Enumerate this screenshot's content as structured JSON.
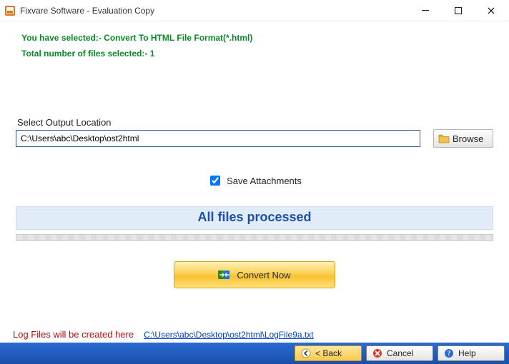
{
  "window": {
    "title": "Fixvare Software - Evaluation Copy"
  },
  "info": {
    "selected_line": "You have selected:- Convert To HTML File Format(*.html)",
    "count_line": "Total number of files selected:- 1"
  },
  "output": {
    "label": "Select Output Location",
    "path": "C:\\Users\\abc\\Desktop\\ost2html",
    "browse_label": "Browse"
  },
  "options": {
    "save_attachments_label": "Save Attachments",
    "save_attachments_checked": true
  },
  "status": {
    "text": "All files processed"
  },
  "actions": {
    "convert_label": "Convert Now"
  },
  "log": {
    "label": "Log Files will be created here",
    "path": "C:\\Users\\abc\\Desktop\\ost2html\\LogFile9a.txt"
  },
  "footer": {
    "back_label": "< Back",
    "cancel_label": "Cancel",
    "help_label": "Help"
  }
}
